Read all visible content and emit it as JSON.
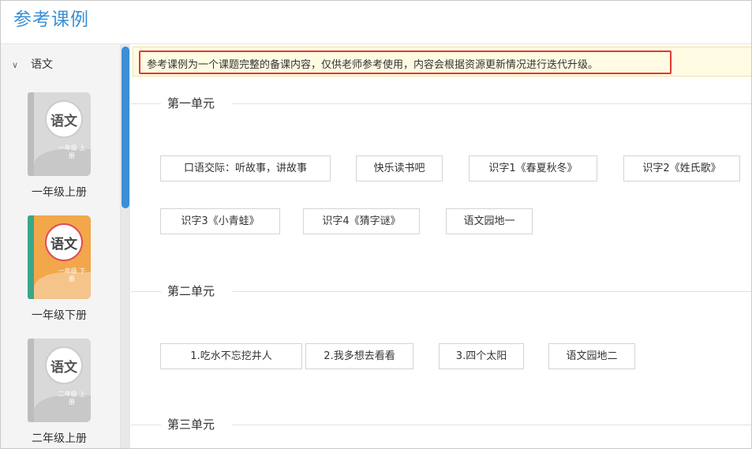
{
  "header": {
    "title": "参考课例"
  },
  "sidebar": {
    "subject": {
      "name": "语文",
      "chevron": "chevron-down-icon"
    },
    "books": [
      {
        "label": "一年级上册",
        "cover_title": "语文",
        "cover_grade": "一年级 上册",
        "style": "gray"
      },
      {
        "label": "一年级下册",
        "cover_title": "语文",
        "cover_grade": "一年级 下册",
        "style": "color"
      },
      {
        "label": "二年级上册",
        "cover_title": "语文",
        "cover_grade": "二年级 上册",
        "style": "gray"
      }
    ]
  },
  "notice": {
    "text": "参考课例为一个课题完整的备课内容，仅供老师参考使用，内容会根据资源更新情况进行迭代升级。"
  },
  "units": [
    {
      "title": "第一单元",
      "lessons": [
        "口语交际：听故事，讲故事",
        "快乐读书吧",
        "识字1《春夏秋冬》",
        "识字2《姓氏歌》",
        "识字3《小青蛙》",
        "识字4《猜字谜》",
        "语文园地一"
      ]
    },
    {
      "title": "第二单元",
      "lessons": [
        "1.吃水不忘挖井人",
        "2.我多想去看看",
        "3.四个太阳",
        "语文园地二"
      ]
    },
    {
      "title": "第三单元",
      "lessons": []
    }
  ],
  "colors": {
    "accent": "#3a8fd6",
    "highlight_border": "#e03a2f",
    "notice_bg": "#fffbe3"
  }
}
